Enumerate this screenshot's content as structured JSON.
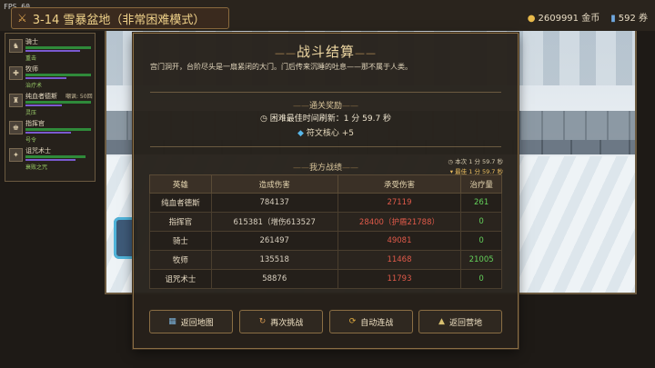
{
  "fps": "FPS 60",
  "topbar": {
    "stage_title": "3-14 雪暴盆地（非常困难模式）",
    "gold": "2609991 金币",
    "tickets": "592 券"
  },
  "party": [
    {
      "name": "骑士",
      "skill": "重击"
    },
    {
      "name": "牧师",
      "skill": "治疗术"
    },
    {
      "name": "纯血者德斯",
      "extra": "嘲讽: 50回",
      "skill": "灵压"
    },
    {
      "name": "指挥官",
      "skill": "号令"
    },
    {
      "name": "诅咒术士",
      "skill": "衰败之咒"
    }
  ],
  "result": {
    "title": "战斗结算",
    "story": "宫门洞开，台阶尽头是一扇紧闭的大门。门后传来沉睡的吐息——那不属于人类。",
    "reward_title": "通关奖励",
    "best_time": "困难最佳时间刷新：1 分 59.7 秒",
    "rune": "符文核心 +5",
    "stats_title": "我方战绩",
    "this_time": "本次 1 分 59.7 秒",
    "best": "最佳 1 分 59.7 秒",
    "headers": [
      "英雄",
      "造成伤害",
      "承受伤害",
      "治疗量"
    ],
    "rows": [
      {
        "hero": "纯血者德斯",
        "dealt": "784137",
        "taken": "27119",
        "heal": "261"
      },
      {
        "hero": "指挥官",
        "dealt": "615381（增伤613527",
        "taken": "28400（护盾21788）",
        "heal": "0"
      },
      {
        "hero": "骑士",
        "dealt": "261497",
        "taken": "49081",
        "heal": "0"
      },
      {
        "hero": "牧师",
        "dealt": "135518",
        "taken": "11468",
        "heal": "21005"
      },
      {
        "hero": "诅咒术士",
        "dealt": "58876",
        "taken": "11793",
        "heal": "0"
      }
    ],
    "buttons": {
      "back_map": "返回地图",
      "retry": "再次挑战",
      "auto": "自动连战",
      "camp": "返回营地"
    }
  }
}
